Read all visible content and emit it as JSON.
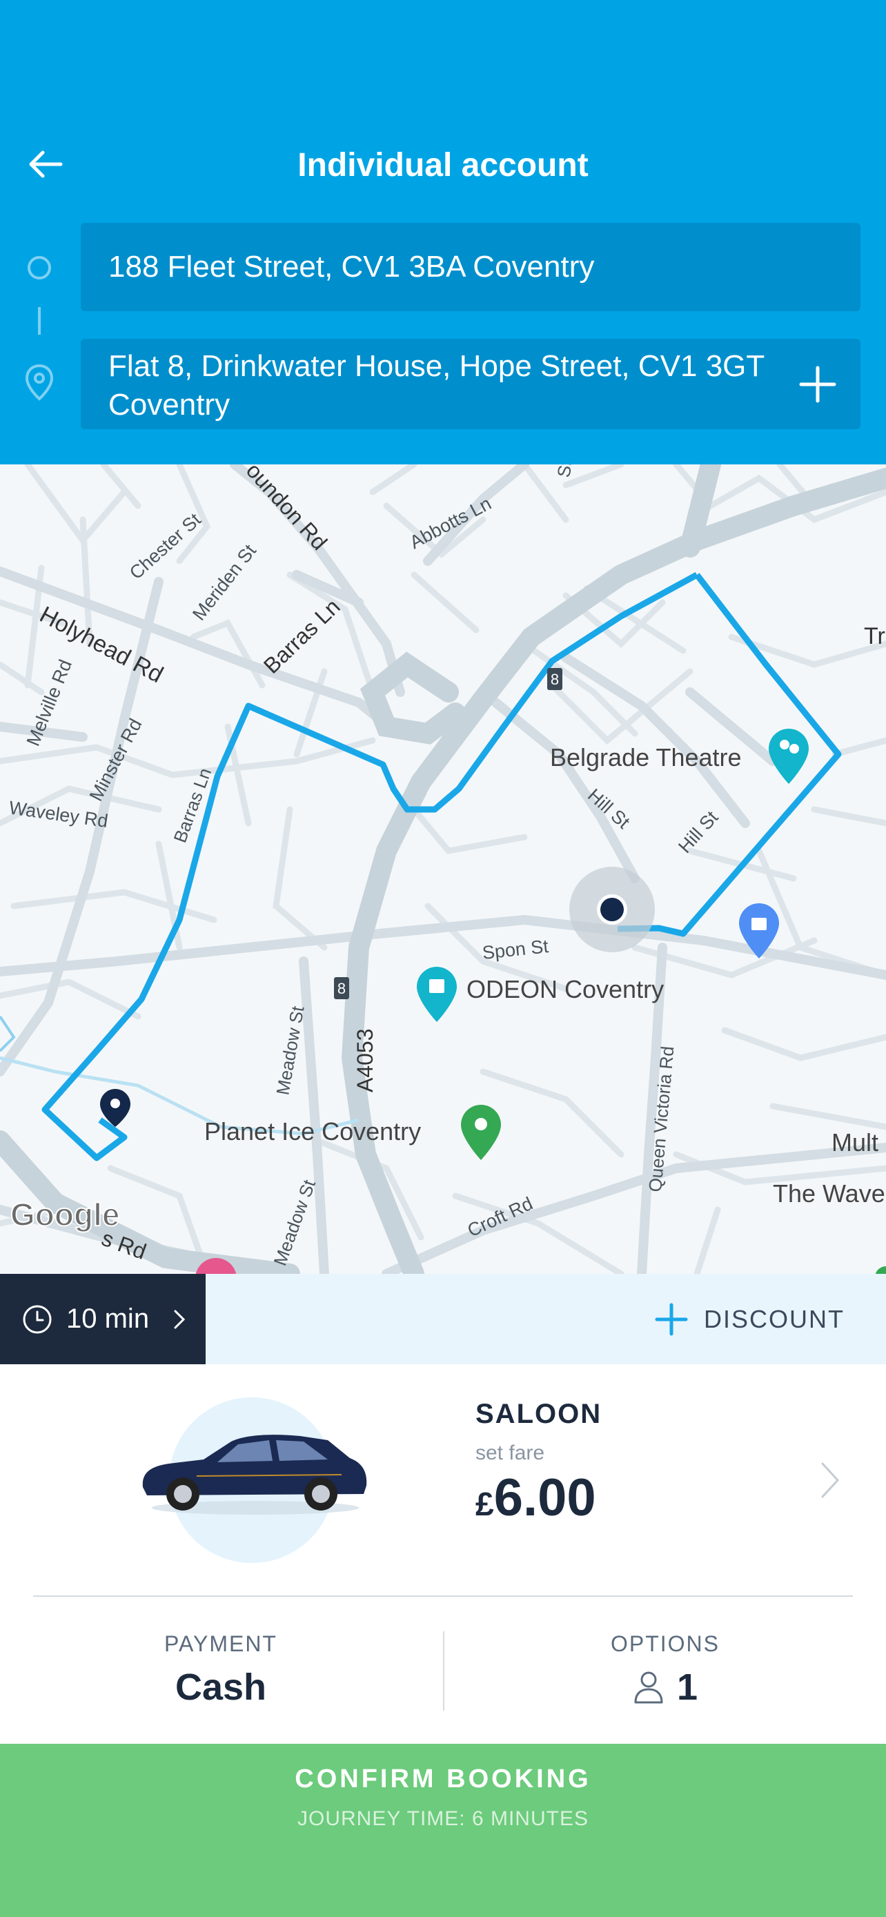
{
  "header": {
    "title": "Individual account",
    "origin": "188 Fleet Street, CV1 3BA Coventry",
    "destination": "Flat 8, Drinkwater House, Hope Street, CV1 3GT Coventry"
  },
  "map": {
    "streets": {
      "holyhead": "Holyhead Rd",
      "barras1": "Barras Ln",
      "barras2": "Barras Ln",
      "chester": "Chester St",
      "meriden": "Meriden St",
      "lower_road_partial": "oundon Rd",
      "abbotts": "Abbotts Ln",
      "melville": "Melville Rd",
      "minster": "Minster Rd",
      "waveley": "Waveley Rd",
      "hill1": "Hill St",
      "hill2": "Hill St",
      "spon": "Spon St",
      "meadow1": "Meadow St",
      "meadow2": "Meadow St",
      "a4053": "A4053",
      "queen_victoria": "Queen Victoria Rd",
      "croft": "Croft Rd",
      "bottom_rd": "s Rd",
      "top_partial_st": "St",
      "right_partial_tr": "Tr"
    },
    "pois": {
      "belgrade": "Belgrade Theatre",
      "odeon": "ODEON Coventry",
      "planet_ice": "Planet Ice Coventry",
      "mult_partial": "Mult",
      "wave_partial": "The Wave"
    },
    "road_badge": "8",
    "google_logo": "Google",
    "colors": {
      "route": "#1aa7e8",
      "road": "#c9d6de",
      "land": "#f4f7f9"
    }
  },
  "eta": {
    "label": "10 min"
  },
  "discount": {
    "label": "DISCOUNT"
  },
  "vehicle": {
    "name": "SALOON",
    "fare_label": "set fare",
    "currency": "£",
    "amount": "6.00"
  },
  "payment": {
    "label": "PAYMENT",
    "value": "Cash"
  },
  "options": {
    "label": "OPTIONS",
    "passengers": "1"
  },
  "confirm": {
    "title": "CONFIRM BOOKING",
    "subtitle": "JOURNEY TIME: 6 MINUTES"
  },
  "icons": {
    "back": "arrow-left-icon",
    "origin": "origin-circle-icon",
    "destination": "location-pin-icon",
    "add_stop": "plus-icon",
    "clock": "clock-icon",
    "person": "person-icon"
  },
  "colors": {
    "header": "#00a4e4",
    "field": "#008fcc",
    "dark": "#1d2a3d",
    "confirm": "#6ccb7c"
  }
}
